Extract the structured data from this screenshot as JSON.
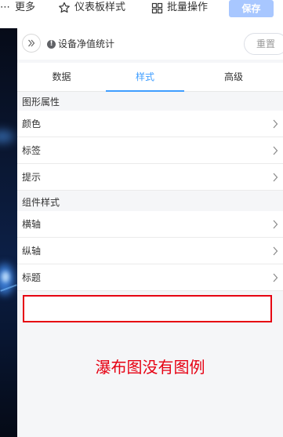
{
  "toolbar": {
    "more_label": "更多",
    "dashboard_style_label": "仪表板样式",
    "batch_label": "批量操作",
    "save_label": "保存"
  },
  "panel": {
    "title": "设备净值统计",
    "reset_label": "重置",
    "tabs": [
      "数据",
      "样式",
      "高级"
    ],
    "active_tab": "样式",
    "sections": [
      {
        "title": "图形属性",
        "items": [
          "颜色",
          "标签",
          "提示"
        ]
      },
      {
        "title": "组件样式",
        "items": [
          "横轴",
          "纵轴",
          "标题"
        ]
      }
    ]
  },
  "annotation": "瀑布图没有图例",
  "colors": {
    "accent": "#409eff",
    "save_bg": "#a8c7ff",
    "annotation_red": "#e60012",
    "canvas_dark": "#0a1630"
  },
  "icons": {
    "dashboard": "star-outline-icon",
    "batch": "grid-icon",
    "collapse": "double-chevron-right-icon",
    "info": "info-icon",
    "row_arrow": "chevron-right-icon"
  }
}
